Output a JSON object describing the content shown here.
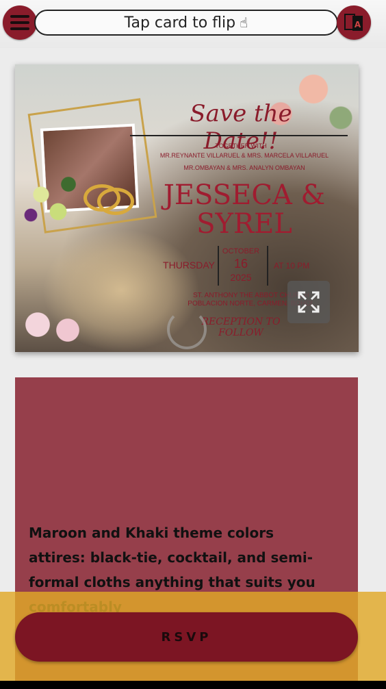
{
  "header": {
    "hint_text": "Tap card to flip",
    "hint_icon": "hand-pointer-icon"
  },
  "invitation": {
    "save_the_date": "Save the Date!!",
    "together_with": "TOGETHER WITH",
    "parents_line1": "MR.REYNANTE VILLARUEL & MRS. MARCELA VILLARUEL",
    "parents_line2": "MR.OMBAYAN & MRS. ANALYN OMBAYAN",
    "names_line1": "JESSECA &",
    "names_line2": "SYREL",
    "day": "THURSDAY",
    "month": "OCTOBER",
    "date": "16",
    "year": "2025",
    "time": "AT 10 PM",
    "venue_line1": "ST. ANTHONY THE ABBOT CHURCH",
    "venue_line2": "POBLACION NORTE, CARMEN, BOHOL",
    "reception": "RECEPTION TO FOLLOW"
  },
  "details": {
    "text": "Maroon and Khaki theme colors attires: black-tie, cocktail, and semi-formal cloths anything that suits you comfortably"
  },
  "rsvp": {
    "label": "RSVP"
  },
  "colors": {
    "maroon": "#8a1c2b",
    "card_maroon": "#963f4b",
    "gold": "#e0a828"
  }
}
